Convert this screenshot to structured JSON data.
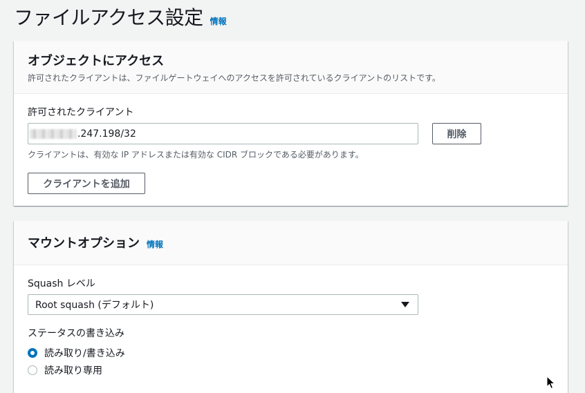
{
  "page": {
    "title": "ファイルアクセス設定",
    "info_link": "情報"
  },
  "access_panel": {
    "title": "オブジェクトにアクセス",
    "description": "許可されたクライアントは、ファイルゲートウェイへのアクセスを許可されているクライアントのリストです。",
    "clients_label": "許可されたクライアント",
    "client_value": ".247.198/32",
    "delete_label": "削除",
    "hint": "クライアントは、有効な IP アドレスまたは有効な CIDR ブロックである必要があります。",
    "add_label": "クライアントを追加"
  },
  "mount_panel": {
    "title": "マウントオプション",
    "info_link": "情報",
    "squash_label": "Squash レベル",
    "squash_value": "Root squash (デフォルト)",
    "status_label": "ステータスの書き込み",
    "options": [
      {
        "label": "読み取り/書き込み",
        "checked": true
      },
      {
        "label": "読み取り専用",
        "checked": false
      }
    ]
  },
  "colors": {
    "accent": "#0073bb",
    "background": "#f2f3f3",
    "text": "#16191f",
    "muted": "#545b64"
  },
  "icons": [
    "caret-down-icon",
    "mouse-cursor-icon"
  ]
}
